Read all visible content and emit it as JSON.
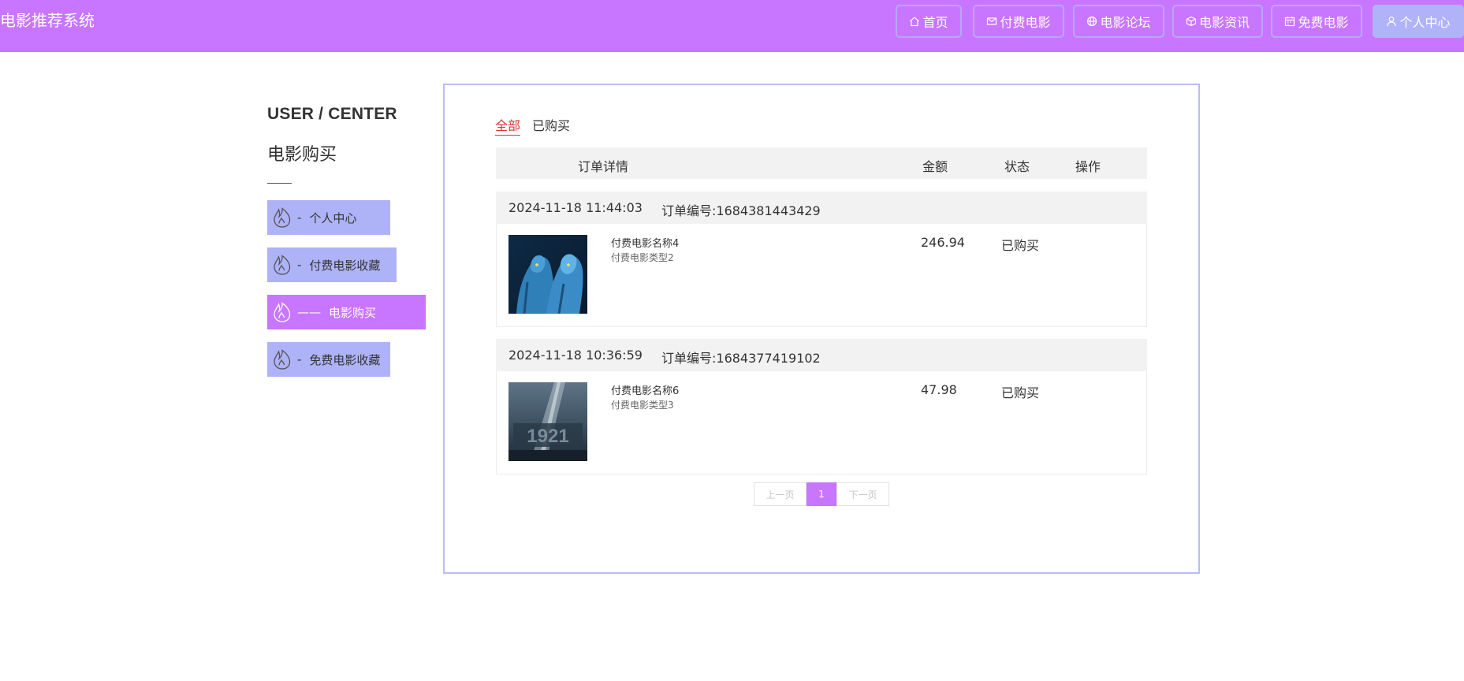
{
  "header": {
    "brand": "电影推荐系统",
    "nav": [
      {
        "label": "首页",
        "icon": "home-icon"
      },
      {
        "label": "付费电影",
        "icon": "mail-icon"
      },
      {
        "label": "电影论坛",
        "icon": "globe-icon"
      },
      {
        "label": "电影资讯",
        "icon": "cube-icon"
      },
      {
        "label": "免费电影",
        "icon": "calendar-icon"
      },
      {
        "label": "个人中心",
        "icon": "user-icon",
        "active": true
      }
    ]
  },
  "sidebar": {
    "title": "USER / CENTER",
    "subtitle": "电影购买",
    "items": [
      {
        "label": "个人中心",
        "dash": "-"
      },
      {
        "label": "付费电影收藏",
        "dash": "-"
      },
      {
        "label": "电影购买",
        "dash": "——",
        "active": true
      },
      {
        "label": "免费电影收藏",
        "dash": "-"
      }
    ]
  },
  "tabs": {
    "all": "全部",
    "bought": "已购买"
  },
  "table": {
    "headers": {
      "detail": "订单详情",
      "amount": "金额",
      "status": "状态",
      "action": "操作"
    }
  },
  "orders": [
    {
      "datetime": "2024-11-18 11:44:03",
      "order_no": "订单编号:1684381443429",
      "movie_name": "付费电影名称4",
      "movie_type": "付费电影类型2",
      "amount": "246.94",
      "status": "已购买",
      "poster_icon": "avatar-movie-poster"
    },
    {
      "datetime": "2024-11-18 10:36:59",
      "order_no": "订单编号:1684377419102",
      "movie_name": "付费电影名称6",
      "movie_type": "付费电影类型3",
      "amount": "47.98",
      "status": "已购买",
      "poster_icon": "1921-movie-poster"
    }
  ],
  "pagination": {
    "prev": "上一页",
    "current": "1",
    "next": "下一页"
  },
  "colors": {
    "accent": "#c876ff",
    "sidebar": "#aeb2f7",
    "tab_active": "#d93434"
  }
}
